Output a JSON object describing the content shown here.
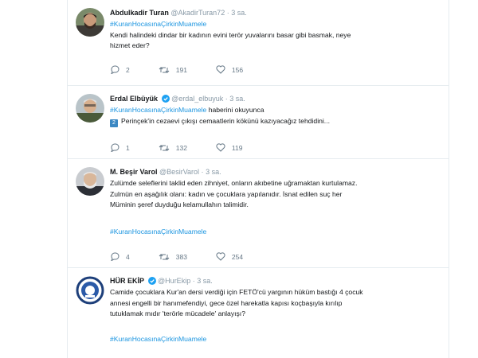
{
  "tweets": [
    {
      "name": "Abdulkadir Turan",
      "handle": "@AkadirTuran72",
      "time": "3 sa.",
      "verified": false,
      "avatar_icon": "user-avatar-photo",
      "lines": [
        "#KuranHocasınaÇirkinMuamele",
        "Kendi halindeki dindar bir kadının evini terör yuvalarını basar gibi basmak, neye",
        "hizmet eder?"
      ],
      "hashtag_after": "",
      "replies": "2",
      "retweets": "191",
      "likes": "156"
    },
    {
      "name": "Erdal Elbüyük",
      "handle": "@erdal_elbuyuk",
      "time": "3 sa.",
      "verified": true,
      "avatar_icon": "user-avatar-photo",
      "lines": [
        "#KuranHocasınaÇirkinMuamele haberini okuyunca",
        "Perinçek'in cezaevi çıkışı cemaatlerin kökünü kazıyacağız tehdidini..."
      ],
      "emoji": "2",
      "hashtag_after": "",
      "replies": "1",
      "retweets": "132",
      "likes": "119"
    },
    {
      "name": "M. Beşir Varol",
      "handle": "@BesirVarol",
      "time": "3 sa.",
      "verified": false,
      "avatar_icon": "user-avatar-photo",
      "lines": [
        "Zulümde seleflerini taklid eden zihniyet, onların akıbetine uğramaktan kurtulamaz.",
        "Zulmün en aşağılık olanı: kadın ve çocuklara yapılanıdır. İsnat edilen suç her",
        "Müminin şeref duyduğu kelamullahın talimidir."
      ],
      "hashtag_after": "#KuranHocasınaÇirkinMuamele",
      "replies": "4",
      "retweets": "383",
      "likes": "254"
    },
    {
      "name": "HÜR EKİP",
      "handle": "@HurEkip",
      "time": "3 sa.",
      "verified": true,
      "avatar_icon": "hur-ekip-logo",
      "lines": [
        "Camide çocuklara Kur'an dersi verdiği için FETÖ'cü yargının hüküm bastığı 4 çocuk",
        "annesi engelli bir hanımefendiyi, gece özel harekatla kapısı koçbaşıyla kırılıp",
        "tutuklamak mıdır 'terörle mücadele' anlayışı?"
      ],
      "hashtag_after": "#KuranHocasınaÇirkinMuamele",
      "replies": "",
      "retweets": "",
      "likes": ""
    }
  ],
  "colors": {
    "link": "#1b95e0",
    "muted": "#8899a6",
    "verified": "#1da1f2",
    "border": "#e6ecf0"
  }
}
